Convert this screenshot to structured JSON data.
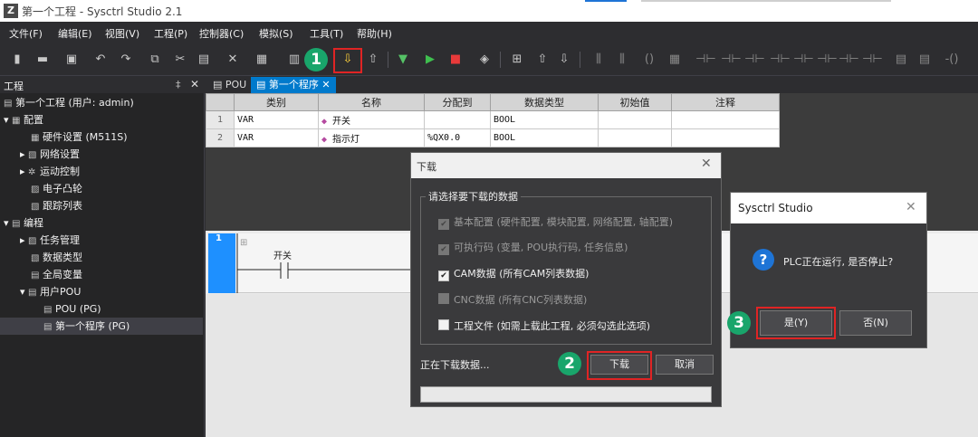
{
  "window": {
    "title": "第一个工程 - Sysctrl Studio 2.1",
    "icon": "app-logo-icon"
  },
  "menu": [
    "文件(F)",
    "编辑(E)",
    "视图(V)",
    "工程(P)",
    "控制器(C)",
    "模拟(S)",
    "工具(T)",
    "帮助(H)"
  ],
  "toolbar": {
    "icons": [
      "new-file-icon",
      "open-folder-icon",
      "save-icon",
      "undo-icon",
      "redo-icon",
      "copy-icon",
      "cut-icon",
      "paste-icon",
      "delete-icon",
      "compile-icon",
      "build-icon",
      "download-icon",
      "upload-icon",
      "debug-icon",
      "run-icon",
      "stop-icon",
      "monitor-icon",
      "network-icon",
      "up-icon",
      "down-icon"
    ],
    "step1": "1"
  },
  "project_panel": {
    "title": "工程",
    "pin": "‡",
    "close": "✕",
    "items": [
      {
        "label": "第一个工程 (用户: admin)",
        "icon": "project-icon",
        "arrow": ""
      },
      {
        "label": "配置",
        "icon": "config-icon",
        "arrow": "▾"
      },
      {
        "label": "硬件设置 (M511S)",
        "icon": "hardware-icon",
        "arrow": ""
      },
      {
        "label": "网络设置",
        "icon": "network-icon",
        "arrow": "▸"
      },
      {
        "label": "运动控制",
        "icon": "motion-icon",
        "arrow": "▸"
      },
      {
        "label": "电子凸轮",
        "icon": "cam-icon",
        "arrow": ""
      },
      {
        "label": "跟踪列表",
        "icon": "trace-icon",
        "arrow": ""
      },
      {
        "label": "编程",
        "icon": "program-icon",
        "arrow": "▾"
      },
      {
        "label": "任务管理",
        "icon": "task-icon",
        "arrow": "▸"
      },
      {
        "label": "数据类型",
        "icon": "datatype-icon",
        "arrow": ""
      },
      {
        "label": "全局变量",
        "icon": "global-var-icon",
        "arrow": ""
      },
      {
        "label": "用户POU",
        "icon": "folder-icon",
        "arrow": "▾"
      },
      {
        "label": "POU (PG)",
        "icon": "pou-icon",
        "arrow": ""
      },
      {
        "label": "第一个程序 (PG)",
        "icon": "pou-icon",
        "arrow": ""
      }
    ]
  },
  "tabs": [
    {
      "label": "POU"
    },
    {
      "label": "第一个程序"
    }
  ],
  "var_table": {
    "headers": [
      "",
      "类别",
      "名称",
      "分配到",
      "数据类型",
      "初始值",
      "注释"
    ],
    "rows": [
      {
        "num": "1",
        "category": "VAR",
        "name": "开关",
        "assign": "",
        "type": "BOOL",
        "init": "",
        "comment": ""
      },
      {
        "num": "2",
        "category": "VAR",
        "name": "指示灯",
        "assign": "%QX0.0",
        "type": "BOOL",
        "init": "",
        "comment": ""
      }
    ]
  },
  "ladder": {
    "rung": "1",
    "contact_label": "开关"
  },
  "download_dialog": {
    "title": "下载",
    "group_title": "请选择要下载的数据",
    "options": [
      {
        "label": "基本配置 (硬件配置, 模块配置, 网络配置, 轴配置)",
        "checked": true,
        "enabled": false
      },
      {
        "label": "可执行码 (变量, POU执行码, 任务信息)",
        "checked": true,
        "enabled": false
      },
      {
        "label": "CAM数据 (所有CAM列表数据)",
        "checked": true,
        "enabled": true
      },
      {
        "label": "CNC数据 (所有CNC列表数据)",
        "checked": false,
        "enabled": false
      },
      {
        "label": "工程文件 (如需上载此工程, 必须勾选此选项)",
        "checked": false,
        "enabled": true
      }
    ],
    "status": "正在下载数据...",
    "download_button": "下载",
    "cancel_button": "取消",
    "step": "2"
  },
  "confirm_dialog": {
    "title": "Sysctrl Studio",
    "message": "PLC正在运行, 是否停止?",
    "yes_button": "是(Y)",
    "no_button": "否(N)",
    "step": "3"
  },
  "colors": {
    "accent": "#007acc",
    "highlight": "#e02424",
    "step_badge": "#19a56b"
  }
}
